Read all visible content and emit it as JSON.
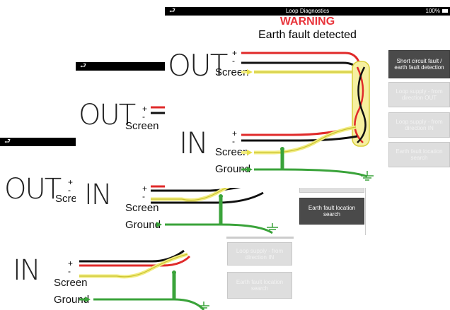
{
  "app": {
    "title": "Loop Diagnostics",
    "battery": "100%",
    "warning": "WARNING",
    "fault_message": "Earth fault detected"
  },
  "diagram": {
    "out_label": "OUT",
    "in_label": "IN",
    "screen_label": "Screen",
    "ground_label": "Ground",
    "plus": "+",
    "minus": "-"
  },
  "buttons": {
    "short_circuit": "Short circuit fault / earth fault detection",
    "loop_supply_out": "Loop supply - from direction OUT",
    "loop_supply_in": "Loop supply - from direction IN",
    "earth_fault_search": "Earth fault location search",
    "direction_in_fragment": "direction IN",
    "loop_supply_in_2": "Loop supply - from direction IN",
    "earth_fault_search_2": "Earth fault location search"
  },
  "colors": {
    "red_wire": "#e02a2a",
    "black_wire": "#111111",
    "yellow_wire": "#e8e04a",
    "green_wire": "#3aa33a",
    "warning": "#e8333a",
    "active_button": "#4a4a4a"
  },
  "icons": {
    "back": "back-arrow-icon",
    "battery": "battery-icon",
    "ground": "ground-symbol-icon"
  }
}
